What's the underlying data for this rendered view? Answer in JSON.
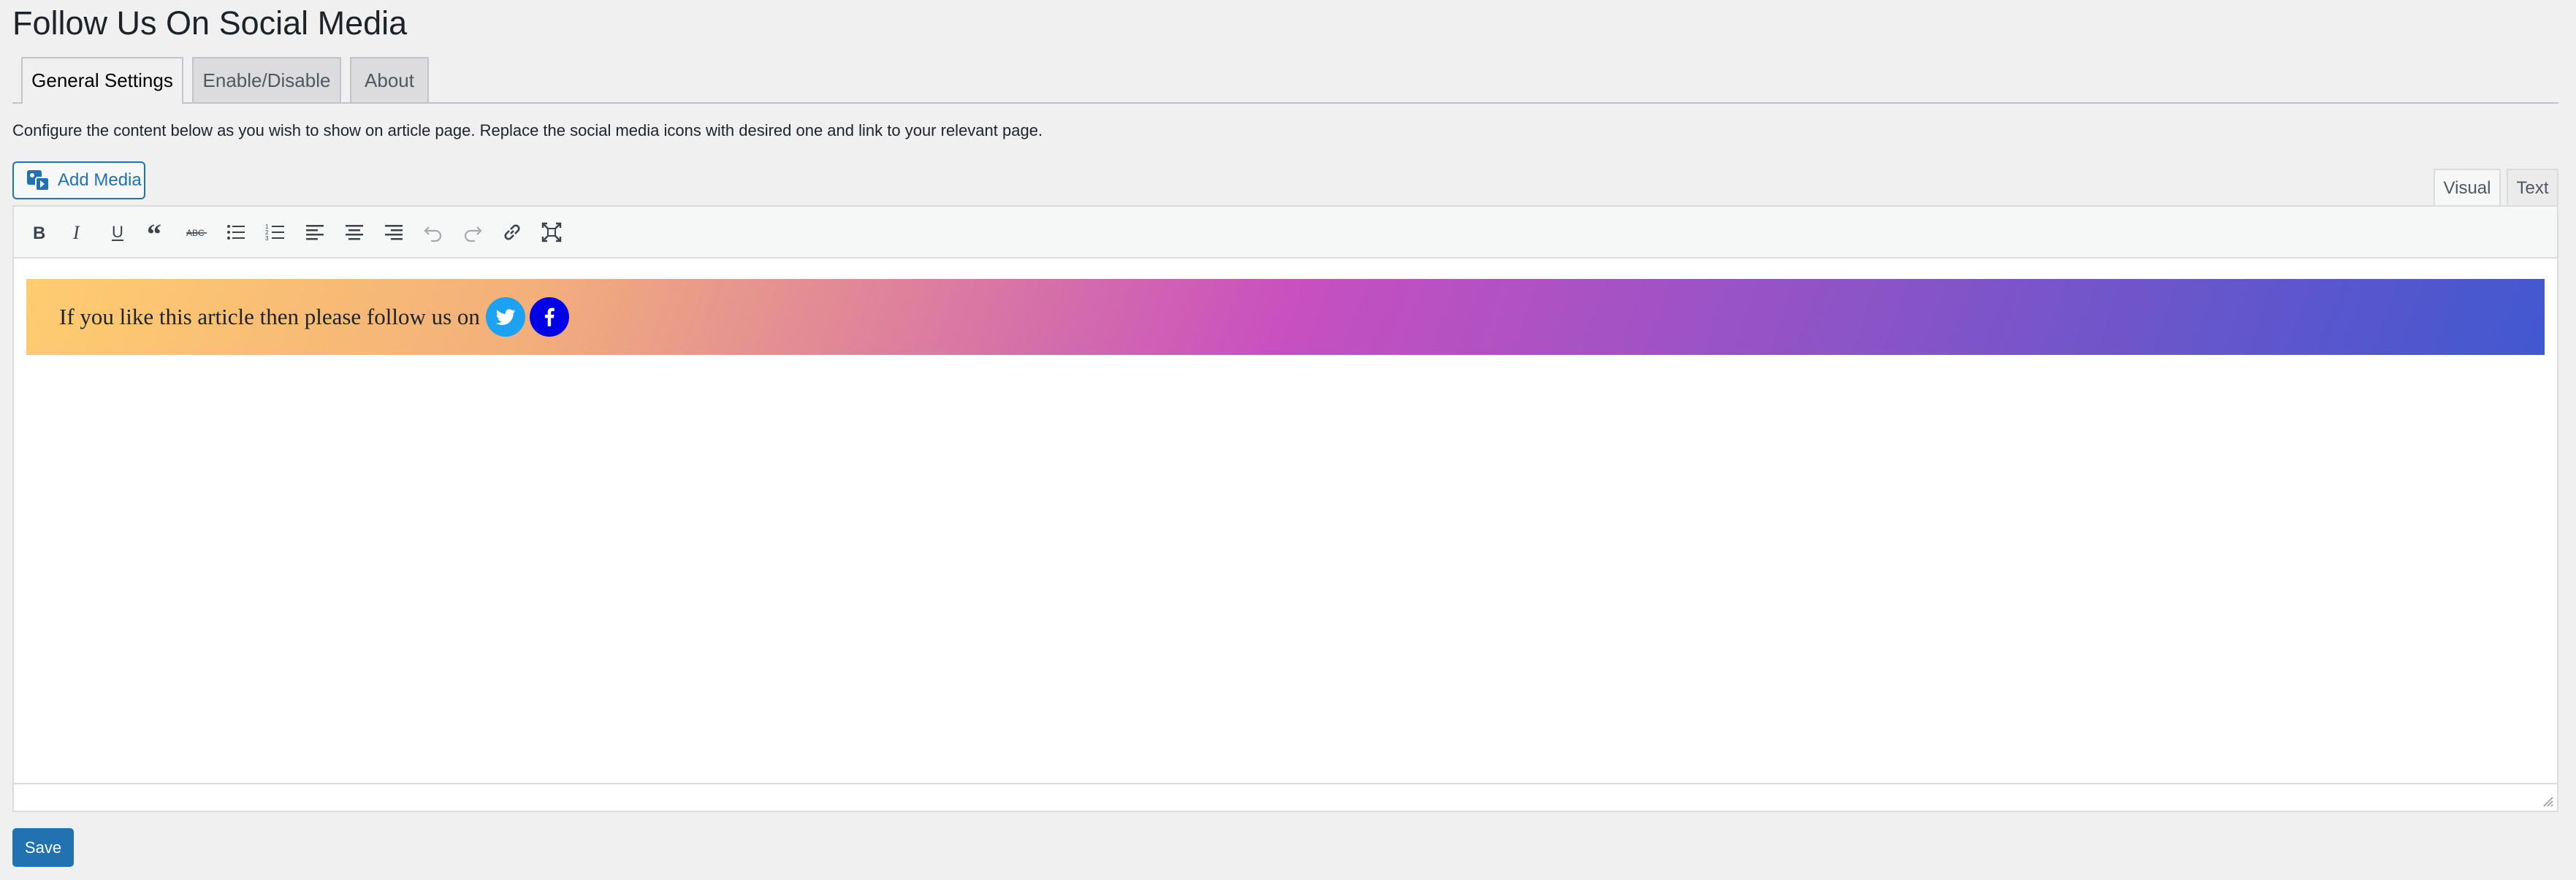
{
  "page": {
    "title": "Follow Us On Social Media"
  },
  "tabs": [
    {
      "label": "General Settings",
      "active": true
    },
    {
      "label": "Enable/Disable",
      "active": false
    },
    {
      "label": "About",
      "active": false
    }
  ],
  "description": "Configure the content below as you wish to show on article page. Replace the social media icons with desired one and link to your relevant page.",
  "editor": {
    "add_media_label": "Add Media",
    "mode_tabs": {
      "visual": "Visual",
      "text": "Text"
    },
    "toolbar": [
      "bold-icon",
      "italic-icon",
      "underline-icon",
      "blockquote-icon",
      "strikethrough-icon",
      "bullet-list-icon",
      "numbered-list-icon",
      "align-left-icon",
      "align-center-icon",
      "align-right-icon",
      "undo-icon",
      "redo-icon",
      "link-icon",
      "fullscreen-icon"
    ],
    "banner_text": "If you like this article then please follow us on",
    "social_icons": [
      "twitter-icon",
      "facebook-icon"
    ],
    "colors": {
      "twitter": "#1da1f2",
      "facebook": "#0000e6",
      "gradient": [
        "#ffcc70",
        "#c850c0",
        "#4158d0"
      ]
    }
  },
  "save_label": "Save"
}
